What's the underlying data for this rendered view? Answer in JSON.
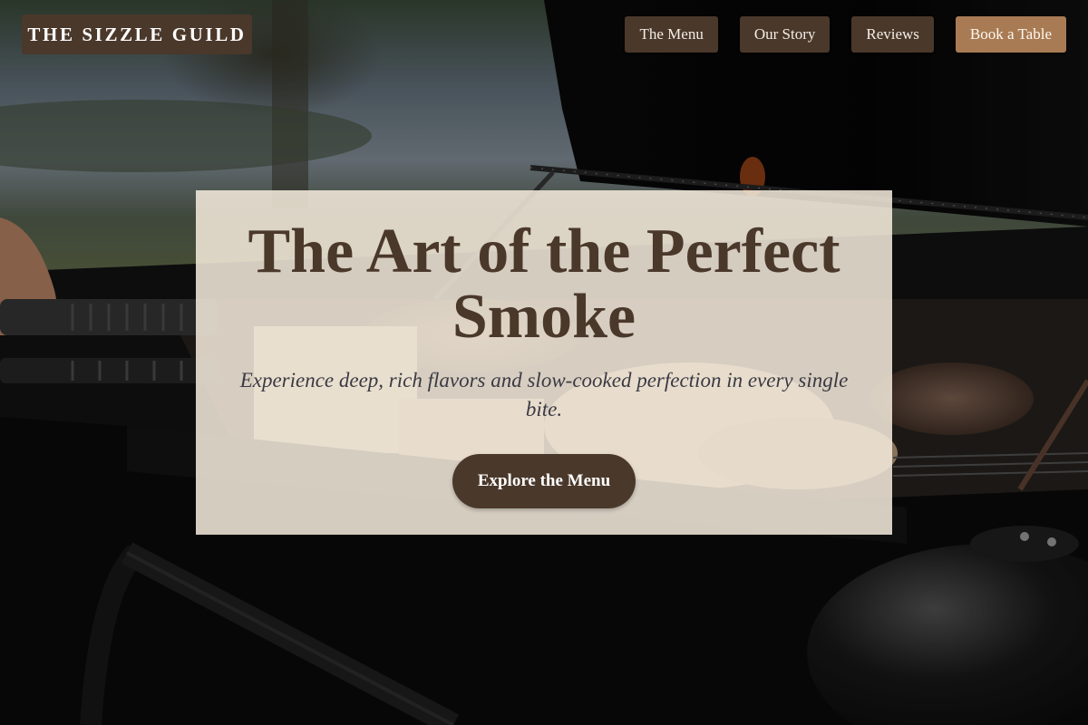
{
  "brand": {
    "name": "THE SIZZLE GUILD"
  },
  "nav": {
    "items": [
      {
        "label": "The Menu"
      },
      {
        "label": "Our Story"
      },
      {
        "label": "Reviews"
      },
      {
        "label": "Book a Table"
      }
    ]
  },
  "hero": {
    "title": "The Art of the Perfect Smoke",
    "subtitle": "Experience deep, rich flavors and slow-cooked perfection in every single bite.",
    "cta_label": "Explore the Menu"
  },
  "colors": {
    "brand_brown": "#4a382b",
    "accent_tan": "#a87b54",
    "card_cream": "#f6ecdd"
  }
}
